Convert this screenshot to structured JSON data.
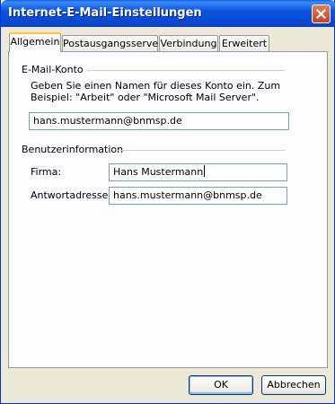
{
  "window": {
    "title": "Internet-E-Mail-Einstellungen"
  },
  "tabs": [
    {
      "label": "Allgemein",
      "active": true
    },
    {
      "label": "Postausgangsserver",
      "active": false
    },
    {
      "label": "Verbindung",
      "active": false
    },
    {
      "label": "Erweitert",
      "active": false
    }
  ],
  "email_account": {
    "heading": "E-Mail-Konto",
    "description": "Geben Sie einen Namen für dieses Konto ein. Zum Beispiel: \"Arbeit\" oder \"Microsoft Mail Server\".",
    "account_name_value": "hans.mustermann@bnmsp.de"
  },
  "user_info": {
    "heading": "Benutzerinformation",
    "company_label": "Firma:",
    "company_value": "Hans Mustermann",
    "reply_label": "Antwortadresse:",
    "reply_value": "hans.mustermann@bnmsp.de"
  },
  "buttons": {
    "ok": "OK",
    "cancel": "Abbrechen"
  },
  "colors": {
    "titlebar": "#0a55e3",
    "accent_tab": "#ffc83c",
    "dialog_bg": "#ece9d8"
  },
  "icons": {
    "close": "close-icon"
  }
}
